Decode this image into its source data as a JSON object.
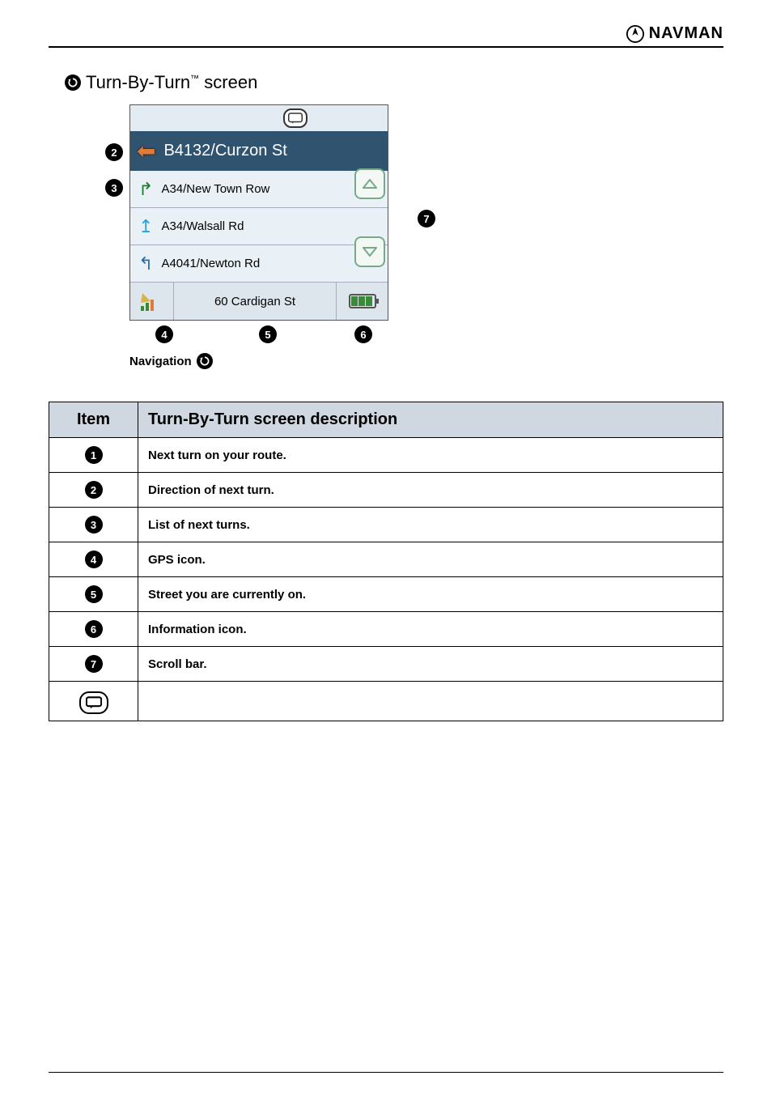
{
  "brand": "NAVMAN",
  "heading": {
    "prefix": "Turn-By-Turn",
    "tm": "™",
    "suffix": "screen"
  },
  "device": {
    "next_turn": "B4132/Curzon St",
    "turns": [
      {
        "label": "A34/New Town Row",
        "arrow_color": "#1f7a2e",
        "arrow": "↱"
      },
      {
        "label": "A34/Walsall Rd",
        "arrow_color": "#2aa3d8",
        "arrow": "↥"
      },
      {
        "label": "A4041/Newton Rd",
        "arrow_color": "#2a6fb0",
        "arrow": "↰"
      }
    ],
    "current_street": "60 Cardigan St"
  },
  "caption": "Navigation",
  "table": {
    "head_item": "Item",
    "head_desc": "Turn-By-Turn screen description",
    "rows": [
      {
        "num": "1",
        "desc": "Next turn on your route."
      },
      {
        "num": "2",
        "desc": "Direction of next turn."
      },
      {
        "num": "3",
        "desc": "List of next turns."
      },
      {
        "num": "4",
        "desc": "GPS icon."
      },
      {
        "num": "5",
        "desc": "Street you are currently on."
      },
      {
        "num": "6",
        "desc": "Information icon."
      },
      {
        "num": "7",
        "desc": "Scroll bar."
      }
    ],
    "icon_row_desc": ""
  }
}
